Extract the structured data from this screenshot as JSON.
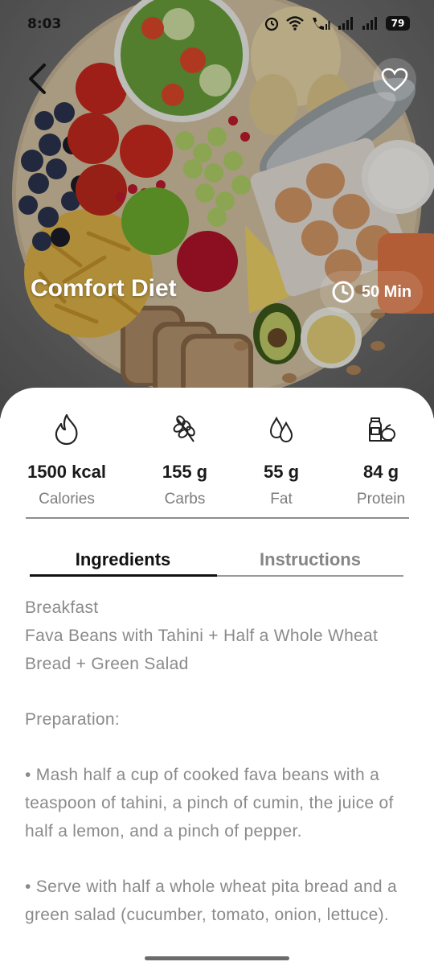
{
  "status_bar": {
    "time": "8:03",
    "battery": "79"
  },
  "hero": {
    "title": "Comfort Diet",
    "duration": "50 Min"
  },
  "nutrition": [
    {
      "icon": "flame-icon",
      "value": "1500 kcal",
      "label": "Calories"
    },
    {
      "icon": "wheat-icon",
      "value": "155 g",
      "label": "Carbs"
    },
    {
      "icon": "drops-icon",
      "value": "55 g",
      "label": "Fat"
    },
    {
      "icon": "protein-food-icon",
      "value": "84 g",
      "label": "Protein"
    }
  ],
  "tabs": [
    {
      "label": "Ingredients",
      "active": true
    },
    {
      "label": "Instructions",
      "active": false
    }
  ],
  "content": {
    "meal": "Breakfast",
    "dish": "Fava Beans with Tahini + Half a Whole Wheat Bread + Green Salad",
    "preparation_heading": "Preparation:",
    "steps": [
      "• Mash half a cup of cooked fava beans with a teaspoon of tahini, a pinch of cumin, the juice of half a lemon, and a pinch of pepper.",
      "• Serve with half a whole wheat pita bread and a green salad (cucumber, tomato, onion, lettuce)."
    ]
  }
}
